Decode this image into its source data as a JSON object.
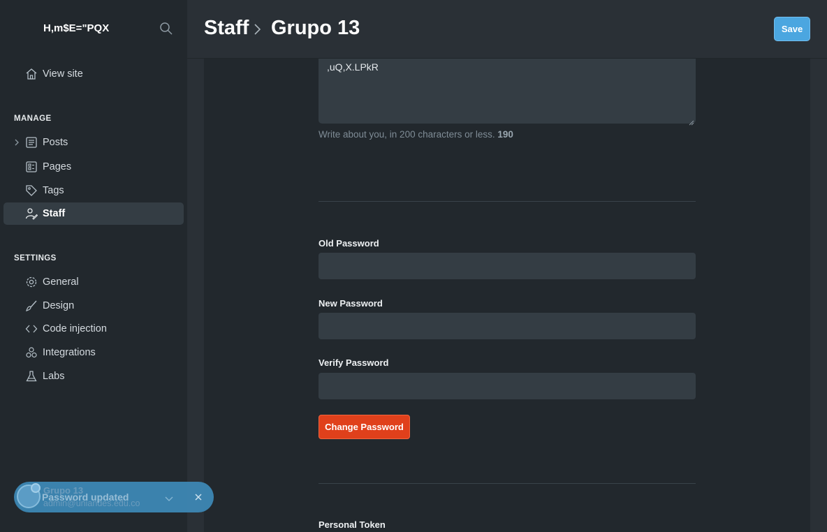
{
  "sidebar": {
    "site_title": "H,m$E=\"PQX",
    "view_site": "View site",
    "manage_heading": "MANAGE",
    "manage_items": [
      {
        "label": "Posts",
        "icon": "posts-icon"
      },
      {
        "label": "Pages",
        "icon": "pages-icon"
      },
      {
        "label": "Tags",
        "icon": "tag-icon"
      },
      {
        "label": "Staff",
        "icon": "staff-icon",
        "active": true
      }
    ],
    "settings_heading": "SETTINGS",
    "settings_items": [
      {
        "label": "General",
        "icon": "gear-icon"
      },
      {
        "label": "Design",
        "icon": "brush-icon"
      },
      {
        "label": "Code injection",
        "icon": "code-icon"
      },
      {
        "label": "Integrations",
        "icon": "integrations-icon"
      },
      {
        "label": "Labs",
        "icon": "flask-icon"
      }
    ]
  },
  "header": {
    "breadcrumb_parent": "Staff",
    "breadcrumb_current": "Grupo 13",
    "save_label": "Save"
  },
  "form": {
    "bio_value": ",uQ,X.LPkR",
    "bio_hint": "Write about you, in 200 characters or less.",
    "bio_count": "190",
    "old_password_label": "Old Password",
    "new_password_label": "New Password",
    "verify_password_label": "Verify Password",
    "change_password_label": "Change Password",
    "personal_token_label": "Personal Token"
  },
  "user": {
    "name": "Grupo 13",
    "email": "admin@uniandes.edu.co"
  },
  "toast": {
    "message": "Password updated"
  },
  "colors": {
    "accent_blue": "#4ba6e0",
    "danger_red": "#e0401b",
    "sidebar_bg": "#22282d"
  }
}
